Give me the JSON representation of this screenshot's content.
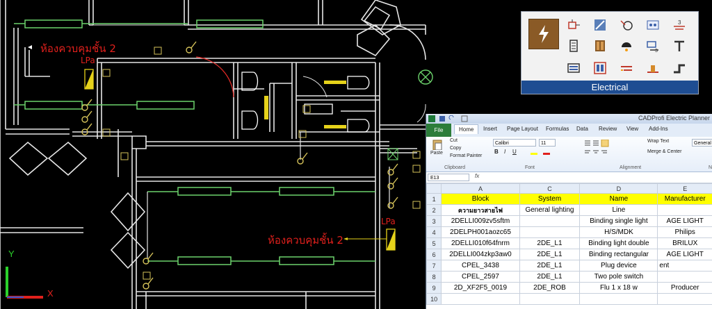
{
  "drawing": {
    "room_label_top": "ห้องควบคุมชั้น 2",
    "room_label_right": "ห้องควบคุมชั้น 2",
    "panel_label_top": "LPa",
    "panel_label_right": "LPa",
    "axis_y": "Y",
    "axis_x": "X",
    "colors": {
      "walls": "#e8e8e8",
      "fixtures": "#6cd36c",
      "labels": "#e0201c",
      "panel": "#e6d21a",
      "tags": "#d6c35a",
      "axis_x": "#e0201c",
      "axis_y": "#2bd12b"
    }
  },
  "palette": {
    "title": "Electrical",
    "icons": [
      "lightning-icon",
      "switchboard-icon",
      "distribution-board-icon",
      "motor-icon",
      "socket-panel-icon",
      "cable-label-icon",
      "meter-icon",
      "cabinet-icon",
      "lamp-icon",
      "junction-icon",
      "terminal-icon",
      "busbar-icon",
      "panel-icon",
      "cable-tray-icon",
      "grounding-icon",
      "riser-icon"
    ]
  },
  "excel": {
    "window_title": "CADProfi Electric Planner",
    "tabs": [
      "File",
      "Home",
      "Insert",
      "Page Layout",
      "Formulas",
      "Data",
      "Review",
      "View",
      "Add-Ins"
    ],
    "ribbon": {
      "paste": "Paste",
      "cut": "Cut",
      "copy": "Copy",
      "format_painter": "Format Painter",
      "clipboard": "Clipboard",
      "font_name": "Calibri",
      "font_size": "11",
      "bold": "B",
      "italic": "I",
      "underline": "U",
      "font_group": "Font",
      "wrap_text": "Wrap Text",
      "merge_center": "Merge & Center",
      "alignment_group": "Alignment",
      "number_format": "General",
      "number_group": "N"
    },
    "name_box": "E13",
    "fx": "fx",
    "columns": [
      "A",
      "C",
      "D",
      "E"
    ],
    "rows": [
      {
        "n": "1",
        "cells": [
          "Block",
          "System",
          "Name",
          "Manufacturer"
        ]
      },
      {
        "n": "2",
        "cells": [
          "ความยาวสายไฟ",
          "General lighting",
          "Line",
          ""
        ]
      },
      {
        "n": "3",
        "cells": [
          "2DELLI009zv5sftm",
          "",
          "Binding single light",
          "AGE LIGHT"
        ]
      },
      {
        "n": "4",
        "cells": [
          "2DELPH001aozc65",
          "",
          "H/S/MDK",
          "Philips"
        ]
      },
      {
        "n": "5",
        "cells": [
          "2DELLI010f64fnrm",
          "2DE_L1",
          "Binding light double",
          "BRILUX"
        ]
      },
      {
        "n": "6",
        "cells": [
          "2DELLI004zkp3aw0",
          "2DE_L1",
          "Binding rectangular",
          "AGE LIGHT"
        ]
      },
      {
        "n": "7",
        "cells": [
          "CPEL_3438",
          "2DE_L1",
          "Plug device",
          "ent"
        ]
      },
      {
        "n": "8",
        "cells": [
          "CPEL_2597",
          "2DE_L1",
          "Two pole switch",
          ""
        ]
      },
      {
        "n": "9",
        "cells": [
          "2D_XF2F5_0019",
          "2DE_ROB",
          "Flu 1 x 18 w",
          "Producer"
        ]
      },
      {
        "n": "10",
        "cells": [
          "",
          "",
          "",
          ""
        ]
      }
    ]
  }
}
